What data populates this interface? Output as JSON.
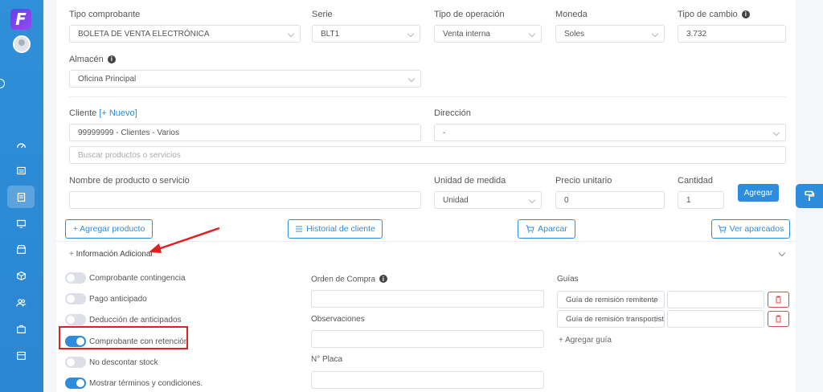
{
  "app": {
    "logo_letter": "F"
  },
  "form": {
    "tipo_comprobante": {
      "label": "Tipo comprobante",
      "value": "BOLETA DE VENTA ELECTRÓNICA"
    },
    "serie": {
      "label": "Serie",
      "value": "BLT1"
    },
    "tipo_operacion": {
      "label": "Tipo de operación",
      "value": "Venta interna"
    },
    "moneda": {
      "label": "Moneda",
      "value": "Soles"
    },
    "tipo_cambio": {
      "label": "Tipo de cambio",
      "value": "3.732"
    },
    "almacen": {
      "label": "Almacén",
      "value": "Oficina Principal"
    },
    "cliente": {
      "label": "Cliente",
      "new_link": "[+ Nuevo]",
      "value": "99999999 - Clientes - Varios"
    },
    "direccion": {
      "label": "Dirección",
      "value": "-"
    },
    "buscar": {
      "placeholder": "Buscar productos o servicios"
    },
    "producto": {
      "label": "Nombre de producto o servicio",
      "value": ""
    },
    "unidad": {
      "label": "Unidad de medida",
      "value": "Unidad"
    },
    "precio": {
      "label": "Precio unitario",
      "value": "0"
    },
    "cantidad": {
      "label": "Cantidad",
      "value": "1"
    },
    "agregar_label": "Agregar"
  },
  "actions": {
    "agregar_producto": "+ Agregar producto",
    "historial": "Historial de cliente",
    "aparcar": "Aparcar",
    "ver_aparcados": "Ver aparcados"
  },
  "info_adicional": {
    "title": "Información Adicional",
    "prefix": "+"
  },
  "toggles": [
    {
      "label": "Comprobante contingencia",
      "on": false
    },
    {
      "label": "Pago anticipado",
      "on": false
    },
    {
      "label": "Deducción de anticipados",
      "on": false
    },
    {
      "label": "Comprobante con retención",
      "on": true
    },
    {
      "label": "No descontar stock",
      "on": false
    },
    {
      "label": "Mostrar términos y condiciones.",
      "on": true
    }
  ],
  "extra": {
    "orden_compra": "Orden de Compra",
    "observaciones": "Observaciones",
    "placa": "N° Placa",
    "guias": "Guías",
    "guia1": "Guía de remisión remitente",
    "guia2": "Guía de remisión transportista",
    "agregar_guia": "+ Agregar guía"
  },
  "colors": {
    "accent": "#2d8cdb",
    "sidebar": "#2b86d3",
    "highlight": "#e02020",
    "danger": "#e04848"
  }
}
